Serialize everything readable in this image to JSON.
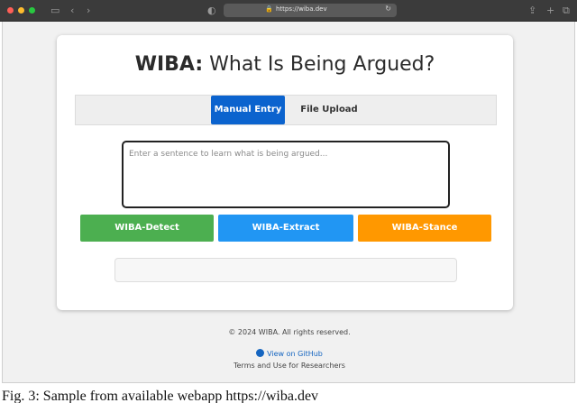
{
  "browser": {
    "url": "https://wiba.dev",
    "colors": {
      "close": "#ff5f57",
      "minimize": "#febc2e",
      "zoom": "#28c840"
    }
  },
  "card": {
    "title_bold": "WIBA:",
    "title_rest": " What Is Being Argued?",
    "tabs": [
      {
        "label": "Manual Entry",
        "active": true
      },
      {
        "label": "File Upload",
        "active": false
      }
    ],
    "input": {
      "placeholder": "Enter a sentence to learn what is being argued..."
    },
    "buttons": [
      {
        "label": "WIBA-Detect",
        "color": "#4caf50"
      },
      {
        "label": "WIBA-Extract",
        "color": "#2196f3"
      },
      {
        "label": "WIBA-Stance",
        "color": "#ff9800"
      }
    ]
  },
  "footer": {
    "copyright": "© 2024 WIBA. All rights reserved.",
    "github_link": "View on GitHub",
    "terms_link": "Terms and Use for Researchers"
  },
  "caption": "Fig. 3: Sample from available webapp https://wiba.dev"
}
